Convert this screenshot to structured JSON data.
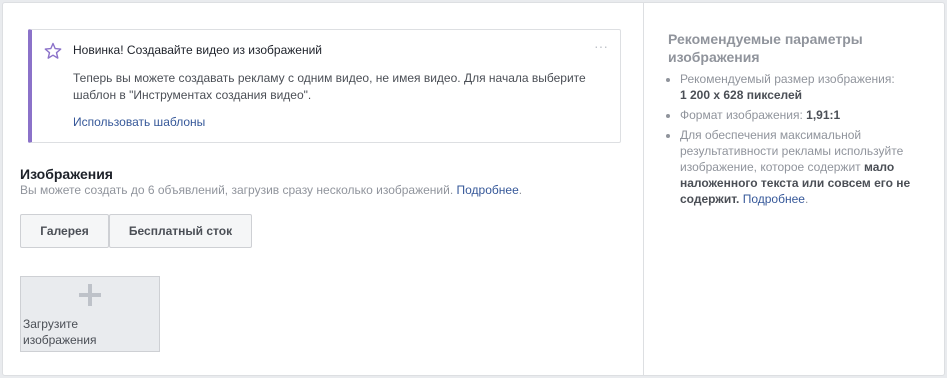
{
  "notice": {
    "title": "Новинка! Создавайте видео из изображений",
    "menu_label": "···",
    "body": "Теперь вы можете создавать рекламу с одним видео, не имея видео. Для начала выберите шаблон в \"Инструментах создания видео\".",
    "link": "Использовать шаблоны",
    "accent_color": "#8b72c9"
  },
  "images_section": {
    "title": "Изображения",
    "description": "Вы можете создать до 6 объявлений, загрузив сразу несколько изображений.",
    "more_link": "Подробнее",
    "period": ".",
    "buttons": {
      "gallery": "Галерея",
      "free_stock": "Бесплатный сток"
    },
    "upload_label": "Загрузите изображения",
    "upload_icon": "plus-icon"
  },
  "sidebar": {
    "title": "Рекомендуемые параметры изображения",
    "size_label": "Рекомендуемый размер изображения:",
    "size_value": "1 200 x 628 пикселей",
    "ratio_label": "Формат изображения:",
    "ratio_value": "1,91:1",
    "tip_part1": "Для обеспечения максимальной результативности рекламы используйте изображение, которое содержит",
    "tip_bold1": "мало наложенного текста",
    "tip_part2": "или",
    "tip_bold2": "совсем его не содержит.",
    "more_link": "Подробнее",
    "period": "."
  },
  "colors": {
    "link": "#365899",
    "muted": "#90949c",
    "border": "#dddfe2"
  }
}
